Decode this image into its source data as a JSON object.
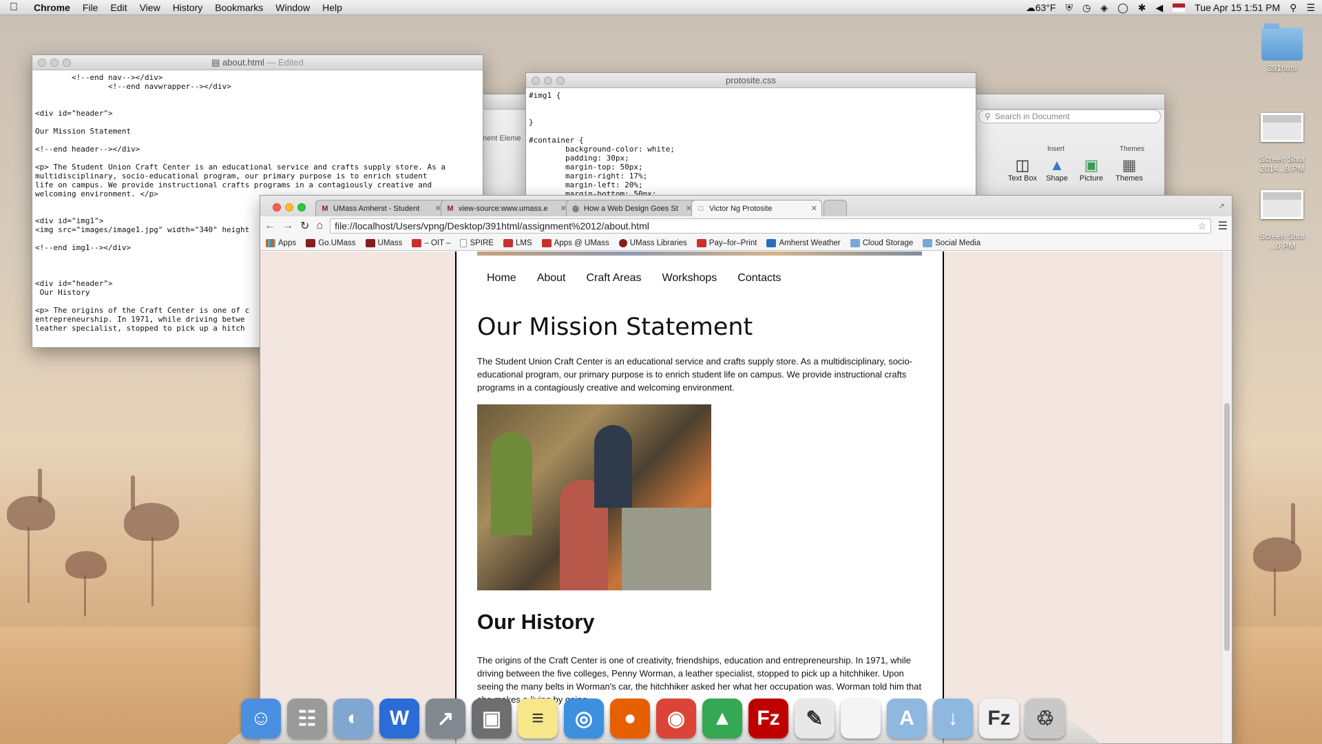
{
  "menubar": {
    "app": "Chrome",
    "items": [
      "File",
      "Edit",
      "View",
      "History",
      "Bookmarks",
      "Window",
      "Help"
    ],
    "weather": "63°F",
    "datetime": "Tue Apr 15  1:51 PM"
  },
  "editor_window": {
    "title": "about.html",
    "status": "— Edited",
    "code": "        <!--end nav--></div>\n                <!--end navwrapper--></div>\n\n\n<div id=\"header\">\n\nOur Mission Statement\n\n<!--end header--></div>\n\n<p> The Student Union Craft Center is an educational service and crafts supply store. As a\nmultidisciplinary, socio-educational program, our primary purpose is to enrich student\nlife on campus. We provide instructional crafts programs in a contagiously creative and\nwelcoming environment. </p>\n\n\n<div id=\"img1\">\n<img src=\"images/image1.jpg\" width=\"340\" height\n\n<!--end img1--></div>\n\n\n\n<div id=\"header\">\n Our History\n\n<p> The origins of the Craft Center is one of c\nentrepreneurship. In 1971, while driving betwe\nleather specialist, stopped to pick up a hitch"
  },
  "css_window": {
    "title": "protosite.css",
    "code": "#img1 {\n\n\n}\n\n#container {\n        background-color: white;\n        padding: 30px;\n        margin-top: 50px;\n        margin-right: 17%;\n        margin-left: 20%;\n        margin-bottom: 50px;"
  },
  "word_window": {
    "search_placeholder": "Search in Document",
    "partial_label": "nent Eleme",
    "ribbon_groups": [
      "Insert",
      "Themes"
    ],
    "ribbon_buttons": [
      "Text Box",
      "Shape",
      "Picture",
      "Themes"
    ]
  },
  "browser": {
    "tabs": [
      {
        "title": "UMass Amherst - Student",
        "icon": "M"
      },
      {
        "title": "view-source:www.umass.e",
        "icon": "M"
      },
      {
        "title": "How a Web Design Goes St",
        "icon": "◎"
      },
      {
        "title": "Victor Ng Protosite",
        "icon": "□"
      }
    ],
    "url": "file://localhost/Users/vpng/Desktop/391html/assignment%2012/about.html",
    "bookmarks": [
      {
        "label": "Apps",
        "color": "#d9534f"
      },
      {
        "label": "Go.UMass",
        "color": "#881c1c"
      },
      {
        "label": "UMass",
        "color": "#881c1c"
      },
      {
        "label": "– OIT –",
        "color": "#c9302c"
      },
      {
        "label": "SPIRE",
        "color": "#ffffff"
      },
      {
        "label": "LMS",
        "color": "#c9302c"
      },
      {
        "label": "Apps @ UMass",
        "color": "#c9302c"
      },
      {
        "label": "UMass Libraries",
        "color": "#881c1c"
      },
      {
        "label": "Pay–for–Print",
        "color": "#c9302c"
      },
      {
        "label": "Amherst Weather",
        "color": "#2a6ebb"
      },
      {
        "label": "Cloud Storage",
        "color": "#7aa7d6"
      },
      {
        "label": "Social Media",
        "color": "#7aa7d6"
      }
    ],
    "page": {
      "nav": [
        "Home",
        "About",
        "Craft Areas",
        "Workshops",
        "Contacts"
      ],
      "heading": "Our Mission Statement",
      "mission": "The Student Union Craft Center is an educational service and crafts supply store. As a multidisciplinary, socio-educational program, our primary purpose is to enrich student life on campus. We provide instructional crafts programs in a contagiously creative and welcoming environment.",
      "history_heading": "Our History",
      "history": "The origins of the Craft Center is one of creativity, friendships, education and entrepreneurship. In 1971, while driving between the five colleges, Penny Worman, a leather specialist, stopped to pick up a hitchhiker. Upon seeing the many belts in Worman's car, the hitchhiker asked her what her occupation was. Worman told him that she makes a living by going"
    }
  },
  "desktop_icons": [
    {
      "label": "391html",
      "type": "folder"
    },
    {
      "label": "Screen Shot\n2014...8 PM",
      "type": "screenshot"
    },
    {
      "label": "Screen Shot\n...0 PM",
      "type": "screenshot"
    }
  ],
  "dock": [
    {
      "name": "finder-icon",
      "color": "#4a8fe0",
      "glyph": "☺"
    },
    {
      "name": "calculator-icon",
      "color": "#9a9a9a",
      "glyph": "☷"
    },
    {
      "name": "preview-icon",
      "color": "#7fa7d0",
      "glyph": "◐"
    },
    {
      "name": "word-icon",
      "color": "#2b6cd6",
      "glyph": "W"
    },
    {
      "name": "launchpad-icon",
      "color": "#808890",
      "glyph": "↗"
    },
    {
      "name": "system-icon",
      "color": "#6e6e6e",
      "glyph": "▣"
    },
    {
      "name": "stickies-icon",
      "color": "#f5e78a",
      "glyph": "≡"
    },
    {
      "name": "safari-icon",
      "color": "#3d8fe0",
      "glyph": "◎"
    },
    {
      "name": "firefox-icon",
      "color": "#e66000",
      "glyph": "●"
    },
    {
      "name": "chrome-icon",
      "color": "#db4437",
      "glyph": "◉"
    },
    {
      "name": "drive-icon",
      "color": "#34a853",
      "glyph": "▲"
    },
    {
      "name": "filezilla-icon",
      "color": "#bf0000",
      "glyph": "Fz"
    },
    {
      "name": "textedit-icon",
      "color": "#e8e8e8",
      "glyph": "✎"
    },
    {
      "name": "document-icon",
      "color": "#f4f4f4",
      "glyph": ""
    },
    {
      "name": "applications-folder-icon",
      "color": "#8fb8df",
      "glyph": "A"
    },
    {
      "name": "downloads-folder-icon",
      "color": "#8fb8df",
      "glyph": "↓"
    },
    {
      "name": "filezilla-doc-icon",
      "color": "#f0f0f0",
      "glyph": "Fz"
    },
    {
      "name": "trash-icon",
      "color": "#c8c8c8",
      "glyph": "♲"
    }
  ]
}
